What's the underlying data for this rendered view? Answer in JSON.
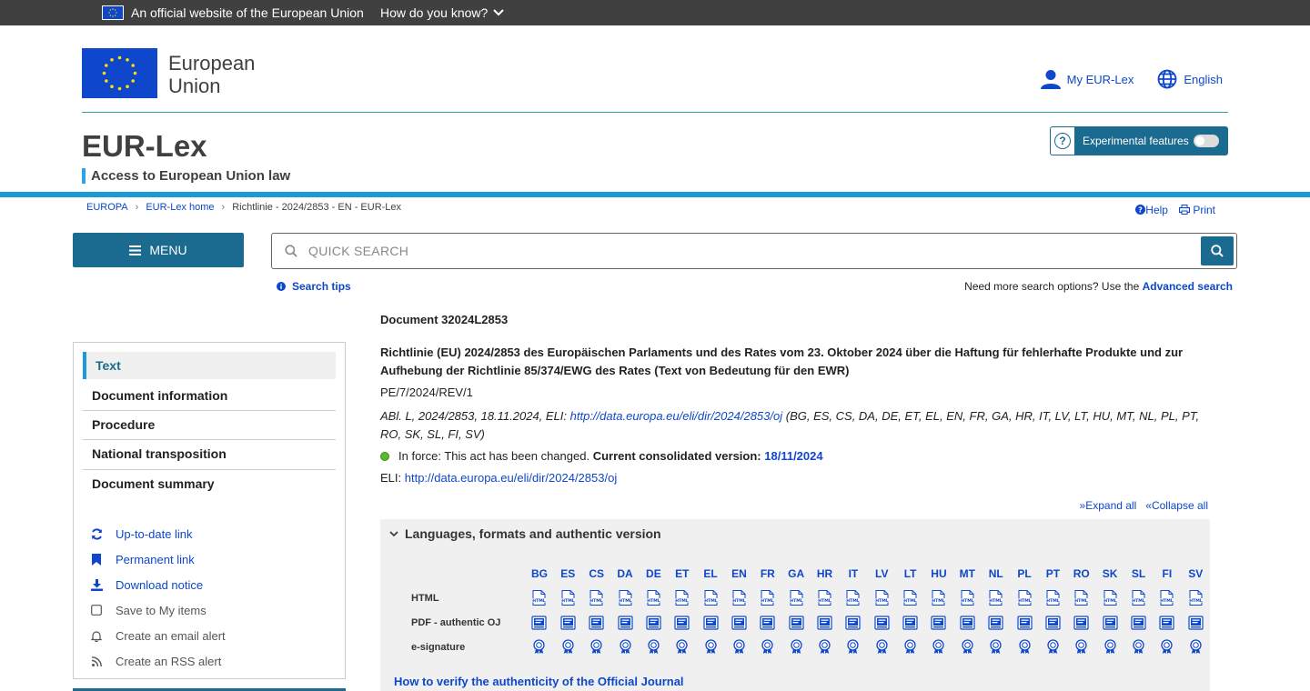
{
  "eu_banner": {
    "official_text": "An official website of the European Union",
    "how_text": "How do you know?"
  },
  "header": {
    "org_name_line1": "European",
    "org_name_line2": "Union",
    "my_eurlex": "My EUR-Lex",
    "language": "English",
    "site_title": "EUR-Lex",
    "tagline": "Access to European Union law",
    "experimental_label": "Experimental features",
    "experimental_on": false
  },
  "breadcrumb": [
    "EUROPA",
    "EUR-Lex home",
    "Richtlinie - 2024/2853 - EN - EUR-Lex"
  ],
  "tools": {
    "help": "Help",
    "print": "Print"
  },
  "menu_label": "MENU",
  "search": {
    "placeholder": "QUICK SEARCH",
    "tips": "Search tips",
    "more_options_text": "Need more search options? Use the",
    "advanced_link": "Advanced search"
  },
  "sidebar": {
    "tabs": [
      "Text",
      "Document information",
      "Procedure",
      "National transposition",
      "Document summary"
    ],
    "active_tab": "Text",
    "links": [
      {
        "label": "Up-to-date link",
        "icon": "refresh-icon",
        "enabled": true
      },
      {
        "label": "Permanent link",
        "icon": "bookmark-icon",
        "enabled": true
      },
      {
        "label": "Download notice",
        "icon": "download-icon",
        "enabled": true
      },
      {
        "label": "Save to My items",
        "icon": "checkbox-icon",
        "enabled": false
      },
      {
        "label": "Create an email alert",
        "icon": "bell-icon",
        "enabled": false
      },
      {
        "label": "Create an RSS alert",
        "icon": "rss-icon",
        "enabled": false
      }
    ]
  },
  "document": {
    "id": "Document 32024L2853",
    "title": "Richtlinie (EU) 2024/2853 des Europäischen Parlaments und des Rates vom 23. Oktober 2024 über die Haftung für fehlerhafte Produkte und zur Aufhebung der Richtlinie 85/374/EWG des Rates (Text von Bedeutung für den EWR)",
    "reference": "PE/7/2024/REV/1",
    "oj_prefix": "ABl. L, 2024/2853, 18.11.2024, ELI: ",
    "oj_link": "http://data.europa.eu/eli/dir/2024/2853/oj",
    "oj_suffix": " (BG, ES, CS, DA, DE, ET, EL, EN, FR, GA, HR, IT, LV, LT, HU, MT, NL, PL, PT, RO, SK, SL, FI, SV)",
    "status_text": "In force: This act has been changed.",
    "consolidated_label": "Current consolidated version:",
    "consolidated_date": "18/11/2024",
    "status_color": "#5bb82c",
    "eli_label": "ELI:",
    "eli_link": "http://data.europa.eu/eli/dir/2024/2853/oj"
  },
  "expand_all": "Expand all",
  "collapse_all": "Collapse all",
  "languages_panel": {
    "heading": "Languages, formats and authentic version",
    "languages": [
      "BG",
      "ES",
      "CS",
      "DA",
      "DE",
      "ET",
      "EL",
      "EN",
      "FR",
      "GA",
      "HR",
      "IT",
      "LV",
      "LT",
      "HU",
      "MT",
      "NL",
      "PL",
      "PT",
      "RO",
      "SK",
      "SL",
      "FI",
      "SV"
    ],
    "rows": [
      {
        "label": "HTML",
        "icon": "html-file-icon"
      },
      {
        "label": "PDF - authentic OJ",
        "icon": "pdf-file-icon"
      },
      {
        "label": "e-signature",
        "icon": "seal-icon"
      }
    ],
    "verify_link": "How to verify the authenticity of the Official Journal"
  },
  "colors": {
    "eu_blue": "#0e47cb",
    "primary": "#1b6a8f",
    "accent": "#1a9ad6",
    "teal": "#2fa5a3"
  }
}
